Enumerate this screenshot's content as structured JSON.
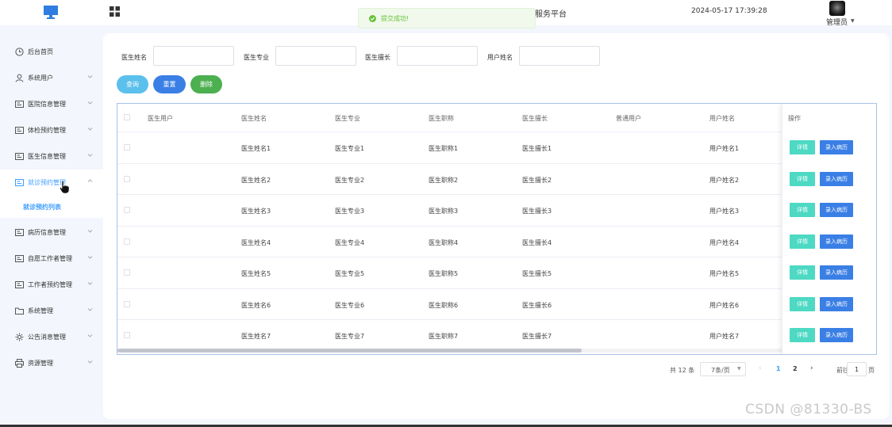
{
  "header": {
    "platform_title": "服务平台",
    "datetime": "2024-05-17 17:39:28",
    "user_name": "管理员"
  },
  "toast": {
    "message": "提交成功!"
  },
  "sidebar": {
    "items": [
      {
        "label": "后台首页"
      },
      {
        "label": "系统用户"
      },
      {
        "label": "医院信息管理"
      },
      {
        "label": "体检预约管理"
      },
      {
        "label": "医生信息管理"
      },
      {
        "label": "就诊预约管理"
      },
      {
        "label": "病历信息管理"
      },
      {
        "label": "自愿工作者管理"
      },
      {
        "label": "工作者预约管理"
      },
      {
        "label": "系统管理"
      },
      {
        "label": "公告消息管理"
      },
      {
        "label": "资源管理"
      }
    ],
    "active_sub": "就诊预约列表"
  },
  "search": {
    "fields": [
      {
        "label": "医生姓名",
        "value": ""
      },
      {
        "label": "医生专业",
        "value": ""
      },
      {
        "label": "医生擅长",
        "value": ""
      },
      {
        "label": "用户姓名",
        "value": ""
      }
    ],
    "buttons": {
      "query": "查询",
      "reset": "重置",
      "delete": "删除"
    }
  },
  "table": {
    "columns": [
      "医生用户",
      "医生姓名",
      "医生专业",
      "医生职称",
      "医生擅长",
      "普通用户",
      "用户姓名"
    ],
    "op_header": "操作",
    "detail_label": "详情",
    "record_label": "录入病历",
    "rows": [
      {
        "doctor_user": "",
        "doctor_name": "医生姓名1",
        "major": "医生专业1",
        "title": "医生职称1",
        "specialty": "医生擅长1",
        "normal_user": "",
        "user_name": "用户姓名1"
      },
      {
        "doctor_user": "",
        "doctor_name": "医生姓名2",
        "major": "医生专业2",
        "title": "医生职称2",
        "specialty": "医生擅长2",
        "normal_user": "",
        "user_name": "用户姓名2"
      },
      {
        "doctor_user": "",
        "doctor_name": "医生姓名3",
        "major": "医生专业3",
        "title": "医生职称3",
        "specialty": "医生擅长3",
        "normal_user": "",
        "user_name": "用户姓名3"
      },
      {
        "doctor_user": "",
        "doctor_name": "医生姓名4",
        "major": "医生专业4",
        "title": "医生职称4",
        "specialty": "医生擅长4",
        "normal_user": "",
        "user_name": "用户姓名4"
      },
      {
        "doctor_user": "",
        "doctor_name": "医生姓名5",
        "major": "医生专业5",
        "title": "医生职称5",
        "specialty": "医生擅长5",
        "normal_user": "",
        "user_name": "用户姓名5"
      },
      {
        "doctor_user": "",
        "doctor_name": "医生姓名6",
        "major": "医生专业6",
        "title": "医生职称6",
        "specialty": "医生擅长6",
        "normal_user": "",
        "user_name": "用户姓名6"
      },
      {
        "doctor_user": "",
        "doctor_name": "医生姓名7",
        "major": "医生专业7",
        "title": "医生职称7",
        "specialty": "医生擅长7",
        "normal_user": "",
        "user_name": "用户姓名7"
      }
    ]
  },
  "pagination": {
    "total": "共 12 条",
    "page_size": "7条/页",
    "pages": [
      "1",
      "2"
    ],
    "current_page": "1",
    "goto_label": "前往",
    "goto_value": "1",
    "goto_unit": "页"
  },
  "watermark": "CSDN @81330-BS",
  "colors": {
    "primary": "#409eff",
    "query_btn": "#5bc0eb",
    "reset_btn": "#3a7fe5",
    "delete_btn": "#4caf50",
    "detail_btn": "#4dd9c3",
    "record_btn": "#3a7fe5",
    "toast_green": "#67c23a"
  },
  "icons": [
    "monitor-icon",
    "grid-icon",
    "check-circle-icon",
    "clock-icon",
    "user-icon",
    "list-icon",
    "folder-icon",
    "gear-icon",
    "printer-icon",
    "chevron-down-icon",
    "chevron-up-icon"
  ]
}
